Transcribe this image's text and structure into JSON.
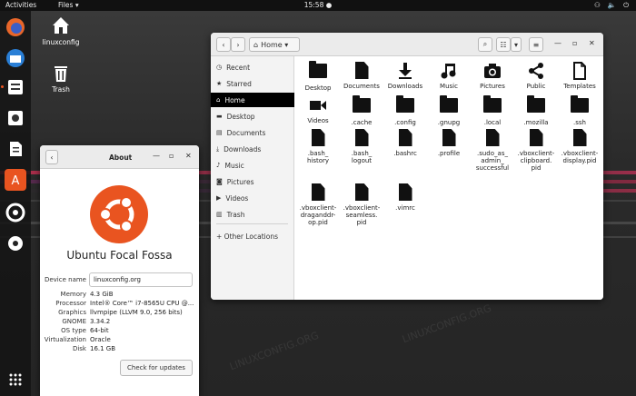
{
  "topbar": {
    "activities": "Activities",
    "files_menu": "Files ▾",
    "clock": "15:58 ●",
    "tray_icons": [
      "network-icon",
      "volume-icon",
      "power-icon"
    ]
  },
  "desktop": {
    "icons": [
      {
        "label": "linuxconfig"
      },
      {
        "label": "Trash"
      }
    ],
    "watermark": "LINUXCONFIG.ORG",
    "stripe_colors": [
      "#e8305a",
      "#d53a4d",
      "#8a3a8a"
    ]
  },
  "files": {
    "path_button": "Home ▾",
    "sidebar": [
      {
        "label": "Recent",
        "icon": "clock-icon"
      },
      {
        "label": "Starred",
        "icon": "star-icon"
      },
      {
        "label": "Home",
        "icon": "home-icon",
        "selected": true
      },
      {
        "label": "Desktop",
        "icon": "folder-icon"
      },
      {
        "label": "Documents",
        "icon": "document-icon"
      },
      {
        "label": "Downloads",
        "icon": "download-icon"
      },
      {
        "label": "Music",
        "icon": "music-icon"
      },
      {
        "label": "Pictures",
        "icon": "camera-icon"
      },
      {
        "label": "Videos",
        "icon": "video-icon"
      },
      {
        "label": "Trash",
        "icon": "trash-icon"
      },
      {
        "label": "+ Other Locations",
        "icon": "plus-icon"
      }
    ],
    "items": [
      {
        "label": "Desktop",
        "type": "folder"
      },
      {
        "label": "Documents",
        "type": "doc"
      },
      {
        "label": "Downloads",
        "type": "download"
      },
      {
        "label": "Music",
        "type": "music"
      },
      {
        "label": "Pictures",
        "type": "camera"
      },
      {
        "label": "Public",
        "type": "share"
      },
      {
        "label": "Templates",
        "type": "doc-outline"
      },
      {
        "label": "Videos",
        "type": "video"
      },
      {
        "label": ".cache",
        "type": "folder"
      },
      {
        "label": ".config",
        "type": "folder"
      },
      {
        "label": ".gnupg",
        "type": "folder"
      },
      {
        "label": ".local",
        "type": "folder"
      },
      {
        "label": ".mozilla",
        "type": "folder"
      },
      {
        "label": ".ssh",
        "type": "folder"
      },
      {
        "label": ".bash_\nhistory",
        "type": "doc"
      },
      {
        "label": ".bash_\nlogout",
        "type": "doc"
      },
      {
        "label": ".bashrc",
        "type": "doc"
      },
      {
        "label": ".profile",
        "type": "doc"
      },
      {
        "label": ".sudo_as_\nadmin_\nsuccessful",
        "type": "doc"
      },
      {
        "label": ".vboxclient-\nclipboard.\npid",
        "type": "doc"
      },
      {
        "label": ".vboxclient-\ndisplay.pid",
        "type": "doc"
      },
      {
        "label": ".vboxclient-\ndraganddr-\nop.pid",
        "type": "doc"
      },
      {
        "label": ".vboxclient-\nseamless.\npid",
        "type": "doc"
      },
      {
        "label": ".vimrc",
        "type": "doc"
      }
    ]
  },
  "about": {
    "title": "About",
    "os_name": "Ubuntu Focal Fossa",
    "device_name_label": "Device name",
    "device_name_value": "linuxconfig.org",
    "rows": [
      {
        "k": "Memory",
        "v": "4.3 GiB"
      },
      {
        "k": "Processor",
        "v": "Intel® Core™ i7-8565U CPU @..."
      },
      {
        "k": "Graphics",
        "v": "llvmpipe (LLVM 9.0, 256 bits)"
      },
      {
        "k": "GNOME",
        "v": "3.34.2"
      },
      {
        "k": "OS type",
        "v": "64-bit"
      },
      {
        "k": "Virtualization",
        "v": "Oracle"
      },
      {
        "k": "Disk",
        "v": "16.1 GB"
      }
    ],
    "check_updates": "Check for updates",
    "brand_color": "#e95420"
  }
}
